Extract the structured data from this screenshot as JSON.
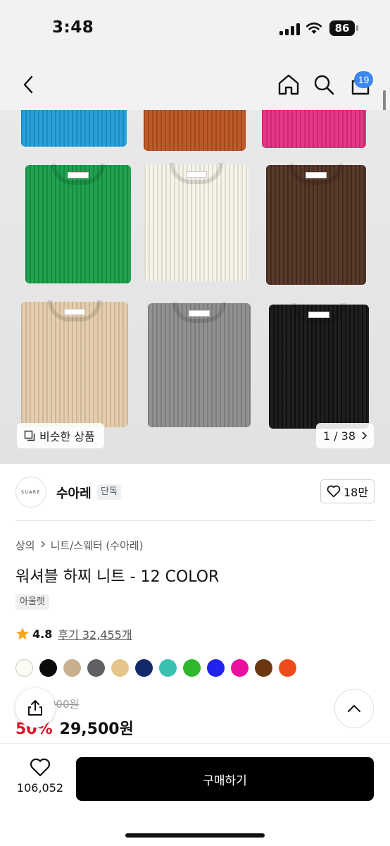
{
  "status_bar": {
    "time": "3:48",
    "battery": "86"
  },
  "nav": {
    "cart_count": "19"
  },
  "gallery": {
    "similar_label": "비슷한 상품",
    "page_indicator": "1 / 38"
  },
  "brand": {
    "logo_text": "SUARE",
    "name": "수아레",
    "exclusive_label": "단독",
    "likes": "18만"
  },
  "breadcrumb": [
    "상의",
    "니트/스웨터 (수아레)"
  ],
  "product": {
    "title": "워셔블 하찌 니트 - 12 COLOR",
    "outlet_label": "아울렛",
    "rating": "4.8",
    "reviews": "후기 32,455개",
    "colors": [
      "#fbfbf4",
      "#0a0a0a",
      "#c8b08f",
      "#5e6064",
      "#e6c68d",
      "#122a6b",
      "#3cc0b0",
      "#2eb82e",
      "#2222ee",
      "#ec10a0",
      "#6b3710",
      "#f04b1a"
    ],
    "original_price": "59,000원",
    "discount": "50%",
    "price": "29,500원"
  },
  "bottom_bar": {
    "wish_count": "106,052",
    "buy_label": "구매하기"
  }
}
